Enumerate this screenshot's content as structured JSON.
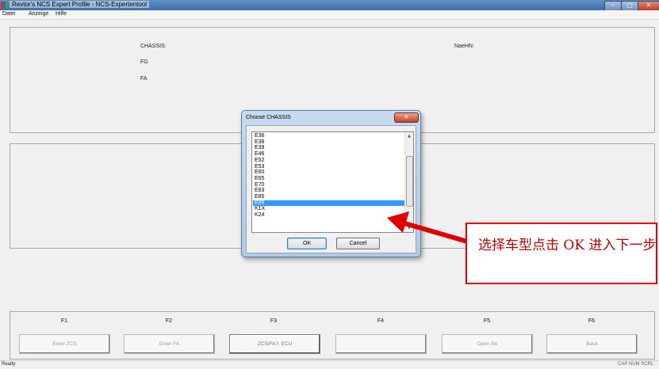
{
  "window": {
    "title": "Revtor's NCS Expert Profile - NCS-Expertentool",
    "min_glyph": "–",
    "max_glyph": "□",
    "close_glyph": "✕"
  },
  "menu": {
    "items": [
      "Datei",
      "Anzeige",
      "Hilfe"
    ]
  },
  "info": {
    "chassis_label": "CHASSIS:",
    "fg_label": "FG",
    "fa_label": "FA",
    "naehn_label": "NaeHN:"
  },
  "fkeys": {
    "labels": [
      "F1",
      "F2",
      "F3",
      "F4",
      "F5",
      "F6"
    ],
    "buttons": [
      "Enter ZCS",
      "Enter FA",
      "ZCS/FA f. ECU",
      "",
      "Open file",
      "Back"
    ]
  },
  "status": {
    "left": "Ready",
    "right": "CAP NUM SCRL"
  },
  "dialog": {
    "title": "Choose CHASSIS",
    "close_glyph": "✕",
    "items": [
      "E36",
      "E38",
      "E39",
      "E46",
      "E52",
      "E53",
      "E60",
      "E65",
      "E70",
      "E83",
      "E85",
      "E89",
      "K1X",
      "K24"
    ],
    "selected": "E89",
    "ok_label": "OK",
    "cancel_label": "Cancel",
    "scroll_up_glyph": "▲",
    "scroll_down_glyph": "▼"
  },
  "annotation": {
    "text": "选择车型点击 OK 进入下一步",
    "color": "#e00000"
  },
  "colors": {
    "selection": "#3399ff",
    "titlebar": "#4a7cb8"
  }
}
